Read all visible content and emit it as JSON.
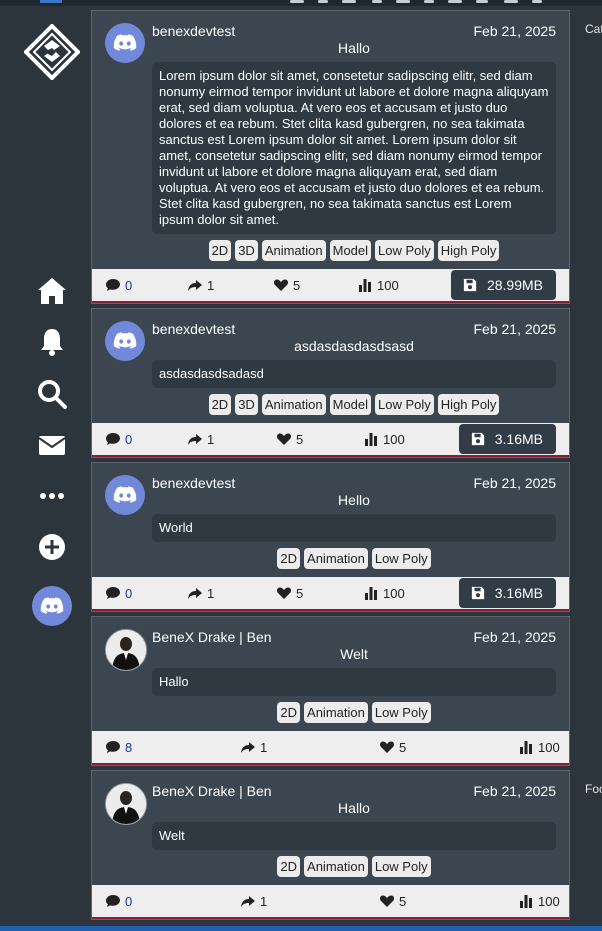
{
  "sidebar": {
    "logo_icon": "hex-logo-icon",
    "items": [
      {
        "name": "home",
        "icon": "home-icon"
      },
      {
        "name": "notifications",
        "icon": "bell-icon"
      },
      {
        "name": "search",
        "icon": "search-icon"
      },
      {
        "name": "messages",
        "icon": "mail-icon"
      },
      {
        "name": "more",
        "icon": "ellipsis-icon"
      },
      {
        "name": "create",
        "icon": "plus-circle-icon"
      }
    ],
    "avatar_icon": "discord-icon"
  },
  "right_panel": {
    "label_top": "Cat",
    "label_bottom": "Foo"
  },
  "colors": {
    "accent_line": "#8c1b36",
    "discord": "#7289da",
    "card": "#3b4651"
  },
  "posts": [
    {
      "username": "benexdevtest",
      "date": "Feb 21, 2025",
      "title": "Hallo",
      "content": "Lorem ipsum dolor sit amet, consetetur sadipscing elitr, sed diam nonumy eirmod tempor invidunt ut labore et dolore magna aliquyam erat, sed diam voluptua. At vero eos et accusam et justo duo dolores et ea rebum. Stet clita kasd gubergren, no sea takimata sanctus est Lorem ipsum dolor sit amet. Lorem ipsum dolor sit amet, consetetur sadipscing elitr, sed diam nonumy eirmod tempor invidunt ut labore et dolore magna aliquyam erat, sed diam voluptua. At vero eos et accusam et justo duo dolores et ea rebum. Stet clita kasd gubergren, no sea takimata sanctus est Lorem ipsum dolor sit amet.",
      "tags": [
        "2D",
        "3D",
        "Animation",
        "Model",
        "Low Poly",
        "High Poly"
      ],
      "comments": "0",
      "shares": "1",
      "likes": "5",
      "views": "100",
      "size": "28.99MB"
    },
    {
      "username": "benexdevtest",
      "date": "Feb 21, 2025",
      "title": "asdasdasdasdsasd",
      "content": "asdasdasdsadasd",
      "tags": [
        "2D",
        "3D",
        "Animation",
        "Model",
        "Low Poly",
        "High Poly"
      ],
      "comments": "0",
      "shares": "1",
      "likes": "5",
      "views": "100",
      "size": "3.16MB"
    },
    {
      "username": "benexdevtest",
      "date": "Feb 21, 2025",
      "title": "Hello",
      "content": "World",
      "tags": [
        "2D",
        "Animation",
        "Low Poly"
      ],
      "comments": "0",
      "shares": "1",
      "likes": "5",
      "views": "100",
      "size": "3.16MB"
    },
    {
      "username": "BeneX Drake | Ben",
      "date": "Feb 21, 2025",
      "title": "Welt",
      "content": "Hallo",
      "tags": [
        "2D",
        "Animation",
        "Low Poly"
      ],
      "comments": "8",
      "shares": "1",
      "likes": "5",
      "views": "100"
    },
    {
      "username": "BeneX Drake | Ben",
      "date": "Feb 21, 2025",
      "title": "Hallo",
      "content": "Welt",
      "tags": [
        "2D",
        "Animation",
        "Low Poly"
      ],
      "comments": "0",
      "shares": "1",
      "likes": "5",
      "views": "100"
    }
  ]
}
